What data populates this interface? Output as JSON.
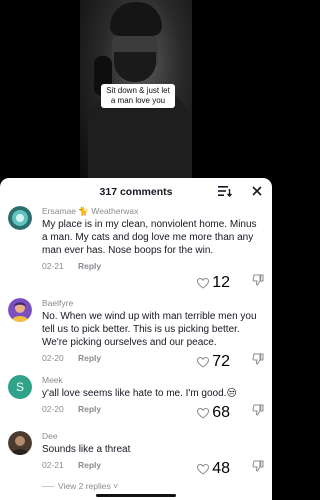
{
  "video": {
    "caption": "Sit down & just let a man love you"
  },
  "sheet": {
    "title": "317 comments",
    "filter_icon": "sort-filter-icon",
    "close_icon": "close-icon"
  },
  "comments": [
    {
      "username": "Ersamae 🐈 Weatherwax",
      "text": "My place is in my clean, nonviolent home. Minus a man. My cats and dog love me more than any man ever has. Nose boops for the win.",
      "date": "02-21",
      "reply_label": "Reply",
      "likes": "12",
      "avatar_color": "#3aa0a0"
    },
    {
      "username": "Baelfyre",
      "text": "No. When we wind up with man terrible men you tell us to pick better. This is us picking better. We're picking ourselves and our peace.",
      "date": "02-20",
      "reply_label": "Reply",
      "likes": "72",
      "avatar_color": "#8a5ad0"
    },
    {
      "username": "Meek",
      "text": "y'all love seems like hate to me. I'm good.😒",
      "date": "02-20",
      "reply_label": "Reply",
      "likes": "68",
      "avatar_letter": "S",
      "avatar_color": "#2fa38a"
    },
    {
      "username": "Dee",
      "text": "Sounds like a threat",
      "date": "02-21",
      "reply_label": "Reply",
      "likes": "48",
      "avatar_color": "#6b5a4a"
    }
  ],
  "view_replies": "View 2 replies ˅"
}
